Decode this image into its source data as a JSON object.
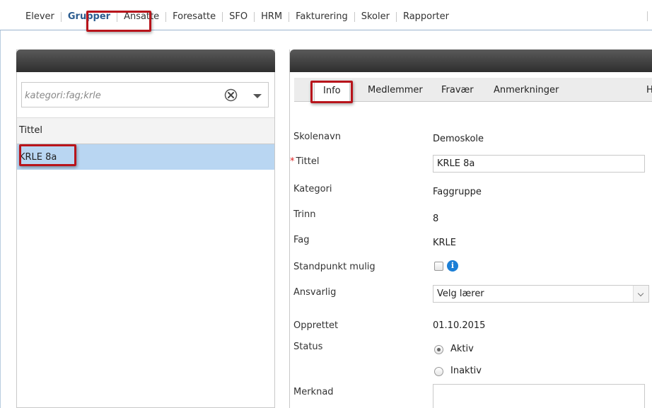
{
  "nav": {
    "items": [
      {
        "label": "Elever",
        "active": false
      },
      {
        "label": "Grupper",
        "active": true
      },
      {
        "label": "Ansatte",
        "active": false
      },
      {
        "label": "Foresatte",
        "active": false
      },
      {
        "label": "SFO",
        "active": false
      },
      {
        "label": "HRM",
        "active": false
      },
      {
        "label": "Fakturering",
        "active": false
      },
      {
        "label": "Skoler",
        "active": false
      },
      {
        "label": "Rapporter",
        "active": false
      }
    ]
  },
  "left": {
    "search_value": "kategori:fag;krle",
    "column_header": "Tittel",
    "rows": [
      "KRLE 8a"
    ]
  },
  "tabs": [
    "Info",
    "Medlemmer",
    "Fravær",
    "Anmerkninger",
    "H"
  ],
  "form": {
    "skolenavn_label": "Skolenavn",
    "skolenavn_value": "Demoskole",
    "required_mark": "*",
    "tittel_label": "Tittel",
    "tittel_value": "KRLE 8a",
    "kategori_label": "Kategori",
    "kategori_value": "Faggruppe",
    "trinn_label": "Trinn",
    "trinn_value": "8",
    "fag_label": "Fag",
    "fag_value": "KRLE",
    "standpunkt_label": "Standpunkt mulig",
    "standpunkt_checked": false,
    "info_glyph": "i",
    "ansvarlig_label": "Ansvarlig",
    "ansvarlig_value": "Velg lærer",
    "opprettet_label": "Opprettet",
    "opprettet_value": "01.10.2015",
    "status_label": "Status",
    "status_options": [
      "Aktiv",
      "Inaktiv"
    ],
    "status_selected": "Aktiv",
    "merknad_label": "Merknad",
    "merknad_value": ""
  },
  "colors": {
    "highlight": "#b8141b",
    "selected_row": "#b9d6f2",
    "panel_header": "#2e2e2e",
    "active_nav": "#2a5b8f"
  }
}
